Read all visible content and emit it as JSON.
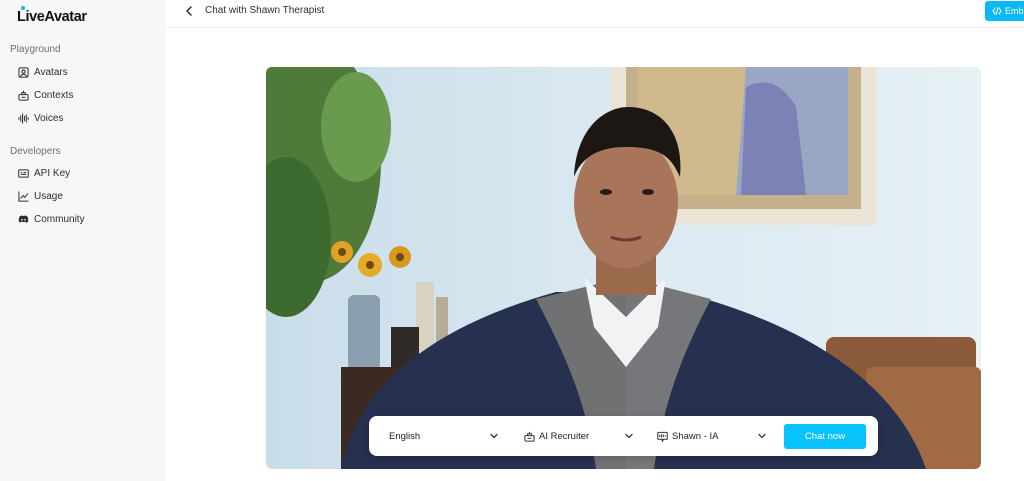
{
  "app": {
    "logo_text": "LiveAvatar",
    "brand_color": "#08c2fb"
  },
  "sidebar": {
    "sections": [
      {
        "label": "Playground",
        "items": [
          {
            "label": "Avatars",
            "icon": "avatar-icon"
          },
          {
            "label": "Contexts",
            "icon": "contexts-icon"
          },
          {
            "label": "Voices",
            "icon": "waveform-icon"
          }
        ]
      },
      {
        "label": "Developers",
        "items": [
          {
            "label": "API Key",
            "icon": "key-card-icon"
          },
          {
            "label": "Usage",
            "icon": "chart-line-icon"
          },
          {
            "label": "Community",
            "icon": "discord-icon"
          }
        ]
      }
    ]
  },
  "header": {
    "title": "Chat with Shawn Therapist",
    "embed_label": "Emb"
  },
  "controls": {
    "language": "English",
    "context": "AI Recruiter",
    "voice": "Shawn - IA",
    "chat_button": "Chat now"
  }
}
